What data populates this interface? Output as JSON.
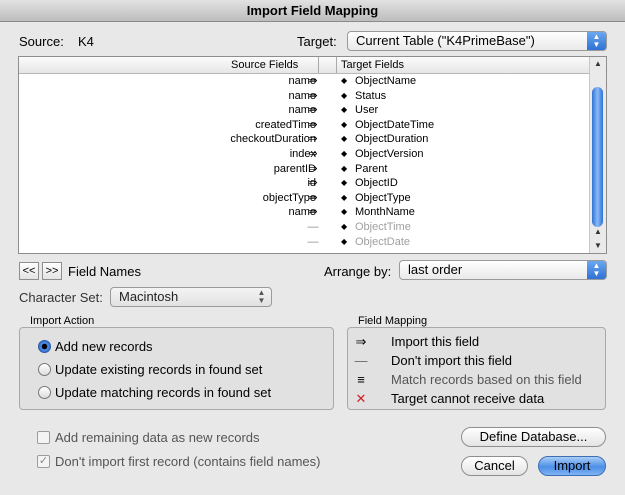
{
  "window": {
    "title": "Import Field Mapping"
  },
  "source": {
    "label": "Source:",
    "value": "K4"
  },
  "target": {
    "label": "Target:",
    "value": "Current Table (\"K4PrimeBase\")"
  },
  "list": {
    "header_source": "Source Fields",
    "header_target": "Target Fields",
    "rows": [
      {
        "source": "name",
        "arrow": "⇒",
        "target": "ObjectName"
      },
      {
        "source": "name",
        "arrow": "⇒",
        "target": "Status"
      },
      {
        "source": "name",
        "arrow": "⇒",
        "target": "User"
      },
      {
        "source": "createdTime",
        "arrow": "⇒",
        "target": "ObjectDateTime"
      },
      {
        "source": "checkoutDuration",
        "arrow": "⇒",
        "target": "ObjectDuration"
      },
      {
        "source": "index",
        "arrow": "⇒",
        "target": "ObjectVersion"
      },
      {
        "source": "parentID",
        "arrow": "⇒",
        "target": "Parent"
      },
      {
        "source": "id",
        "arrow": "⇒",
        "target": "ObjectID"
      },
      {
        "source": "objectType",
        "arrow": "⇒",
        "target": "ObjectType"
      },
      {
        "source": "name",
        "arrow": "⇒",
        "target": "MonthName"
      },
      {
        "source": "",
        "arrow": "—",
        "target": "ObjectTime"
      },
      {
        "source": "",
        "arrow": "—",
        "target": "ObjectDate"
      }
    ]
  },
  "nav": {
    "prev": "<<",
    "next": ">>",
    "label": "Field Names"
  },
  "arrange": {
    "label": "Arrange by:",
    "value": "last order"
  },
  "charset": {
    "label": "Character Set:",
    "value": "Macintosh"
  },
  "import_action": {
    "title": "Import Action",
    "options": [
      "Add new records",
      "Update existing records in found set",
      "Update matching records in found set"
    ],
    "selected": 0
  },
  "field_mapping": {
    "title": "Field Mapping",
    "items": [
      {
        "icon": "⇒",
        "text": "Import this field",
        "icon_name": "import-arrow-icon"
      },
      {
        "icon": "—",
        "text": "Don't import this field",
        "icon_name": "dont-import-dash-icon"
      },
      {
        "icon": "≡",
        "text": "Match records based on this field",
        "icon_name": "match-equals-icon"
      },
      {
        "icon": "✕",
        "text": "Target cannot receive data",
        "icon_name": "cannot-receive-x-icon"
      }
    ]
  },
  "options": {
    "add_remaining": "Add remaining data as new records",
    "dont_import_first": "Don't import first record (contains field names)"
  },
  "buttons": {
    "define": "Define Database...",
    "cancel": "Cancel",
    "import": "Import"
  },
  "colors": {
    "accent": "#3b7fe0",
    "red_x": "#d0202a"
  }
}
